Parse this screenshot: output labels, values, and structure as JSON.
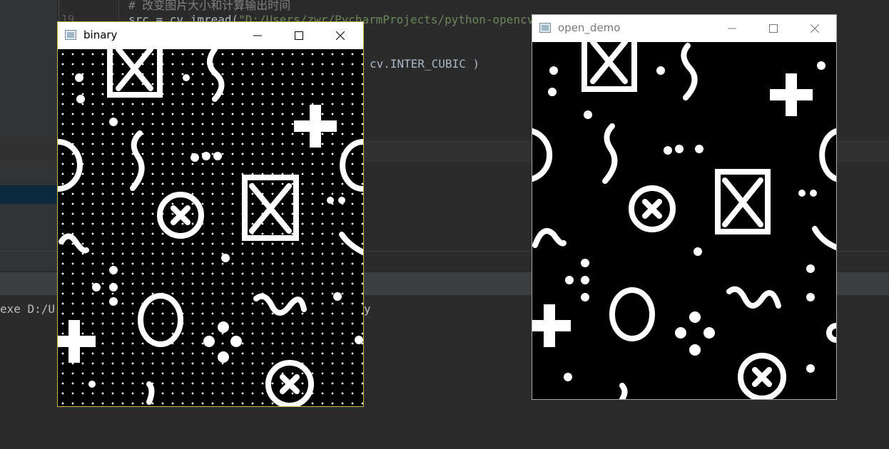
{
  "ide": {
    "line_number": "19",
    "code_comment": "# 改变图片大小和计算输出时间",
    "code_line_src_prefix": "src = cv.imread(",
    "code_line_src_str": "\"D:/Users/zwr/PycharmProjects/python-opencv/...\"",
    "code_cv_call": "cv.INTER_CUBIC )",
    "console_left": "exe D:/U",
    "console_right": "y"
  },
  "windows": {
    "binary": {
      "title": "binary",
      "icon": "opencv-window-icon"
    },
    "open_demo": {
      "title": "open_demo",
      "icon": "opencv-window-icon"
    }
  },
  "window_controls": [
    "minimize-icon",
    "maximize-icon",
    "close-icon"
  ],
  "colors": {
    "ide_bg": "#2b2b2b",
    "code_text": "#a9b7c6",
    "string": "#6a8759",
    "active_border": "#c9b54a"
  }
}
